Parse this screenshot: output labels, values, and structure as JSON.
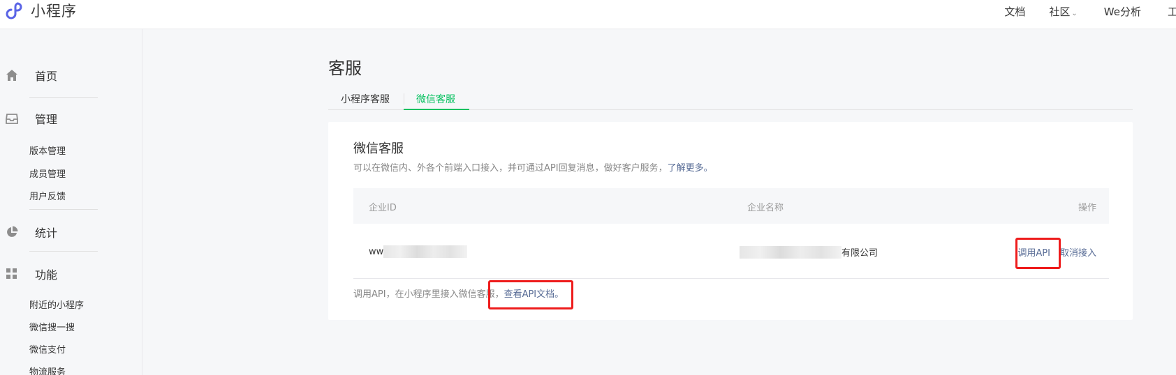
{
  "header": {
    "logo_text": "小程序",
    "nav": {
      "docs": "文档",
      "community": "社区",
      "analysis": "We分析",
      "tools": "工具"
    },
    "accent": "#07c160"
  },
  "sidebar": {
    "home": "首页",
    "manage": {
      "label": "管理",
      "items": [
        "版本管理",
        "成员管理",
        "用户反馈"
      ]
    },
    "stats": "统计",
    "features": {
      "label": "功能",
      "items": [
        "附近的小程序",
        "微信搜一搜",
        "微信支付",
        "物流服务"
      ]
    }
  },
  "main": {
    "title": "客服",
    "tabs": [
      {
        "label": "小程序客服",
        "active": false
      },
      {
        "label": "微信客服",
        "active": true
      }
    ],
    "card": {
      "title": "微信客服",
      "desc": "可以在微信内、外各个前端入口接入，并可通过API回复消息，做好客户服务，",
      "learn_more": "了解更多。",
      "table": {
        "columns": [
          "企业ID",
          "企业名称",
          "操作"
        ],
        "rows": [
          {
            "enterprise_id_prefix": "ww",
            "enterprise_name_suffix": "有限公司",
            "actions": [
              "调用API",
              "取消接入"
            ]
          }
        ]
      },
      "footer_text": "调用API，在小程序里接入微信客服，",
      "footer_link": "查看API文档。"
    }
  }
}
